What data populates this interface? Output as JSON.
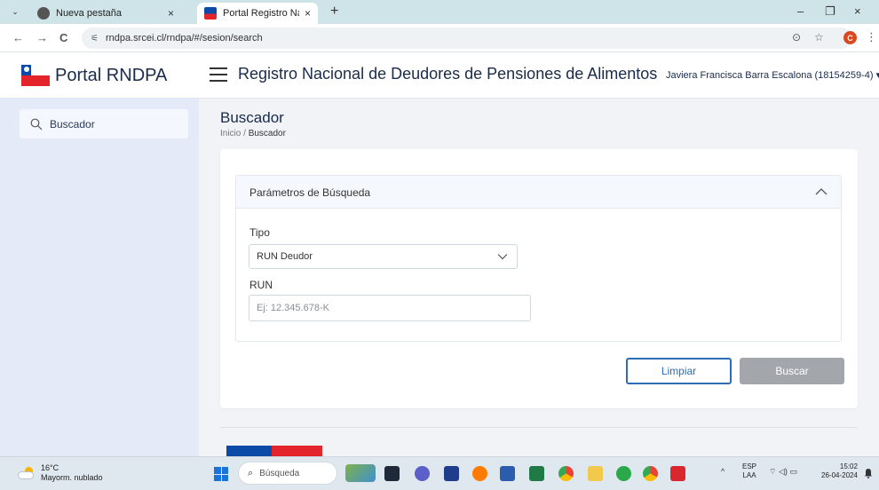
{
  "browser": {
    "tabs": [
      {
        "label": "Nueva pestaña",
        "close": "×"
      },
      {
        "label": "Portal Registro Nacional de De",
        "close": "×"
      }
    ],
    "new_tab": "+",
    "window_controls": {
      "minimize": "–",
      "restore": "❐",
      "close": "×"
    },
    "nav": {
      "back": "←",
      "forward": "→",
      "reload": "C"
    },
    "url": "rndpa.srcei.cl/rndpa/#/sesion/search",
    "profile_initial": "C",
    "menu": "⋮",
    "bookmark": "☆",
    "lens": "⊙"
  },
  "header": {
    "brand": "Portal RNDPA",
    "title": "Registro Nacional de Deudores de Pensiones de Alimentos",
    "user": "Javiera Francisca Barra Escalona (18154259-4)",
    "user_caret": "▾"
  },
  "sidebar": {
    "items": [
      {
        "label": "Buscador",
        "icon": "search-icon"
      }
    ]
  },
  "main": {
    "title": "Buscador",
    "breadcrumb": {
      "home": "Inicio",
      "separator": "/",
      "current": "Buscador"
    },
    "panel": {
      "title": "Parámetros de Búsqueda",
      "tipo_label": "Tipo",
      "tipo_value": "RUN Deudor",
      "run_label": "RUN",
      "run_placeholder": "Ej: 12.345.678-K"
    },
    "buttons": {
      "clear": "Limpiar",
      "search": "Buscar"
    }
  },
  "taskbar": {
    "temperature": "16°C",
    "weather": "Mayorm. nublado",
    "search_placeholder": "Búsqueda",
    "tray_expand": "^",
    "lang_top": "ESP",
    "lang_bottom": "LAA",
    "tray_icons": "⌔ ◁) ▭",
    "time": "15:02",
    "date": "26-04-2024"
  },
  "colors": {
    "primary": "#2d6db5",
    "brand_blue": "#0b4aa6",
    "brand_red": "#e3252b",
    "disabled": "#a3a6aa",
    "sidebar_bg": "#e4eaf7"
  }
}
